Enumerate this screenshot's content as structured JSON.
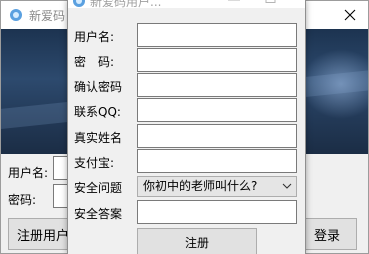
{
  "main_window": {
    "title": "新爱码",
    "username_label": "用户名:",
    "password_label": "密码:",
    "register_button": "注册用户",
    "login_button": "登录"
  },
  "register_dialog": {
    "title": "新爱码用户...",
    "fields": {
      "username_label": "用户名:",
      "password_label": "密　码:",
      "confirm_password_label": "确认密码",
      "qq_label": "联系QQ:",
      "real_name_label": "真实姓名",
      "alipay_label": "支付宝:",
      "security_question_label": "安全问题",
      "security_answer_label": "安全答案"
    },
    "security_question_value": "你初中的老师叫什么?",
    "submit_button": "注册"
  },
  "colors": {
    "dialog_bg": "#f0f0f0",
    "banner_dark": "#1c3350"
  }
}
